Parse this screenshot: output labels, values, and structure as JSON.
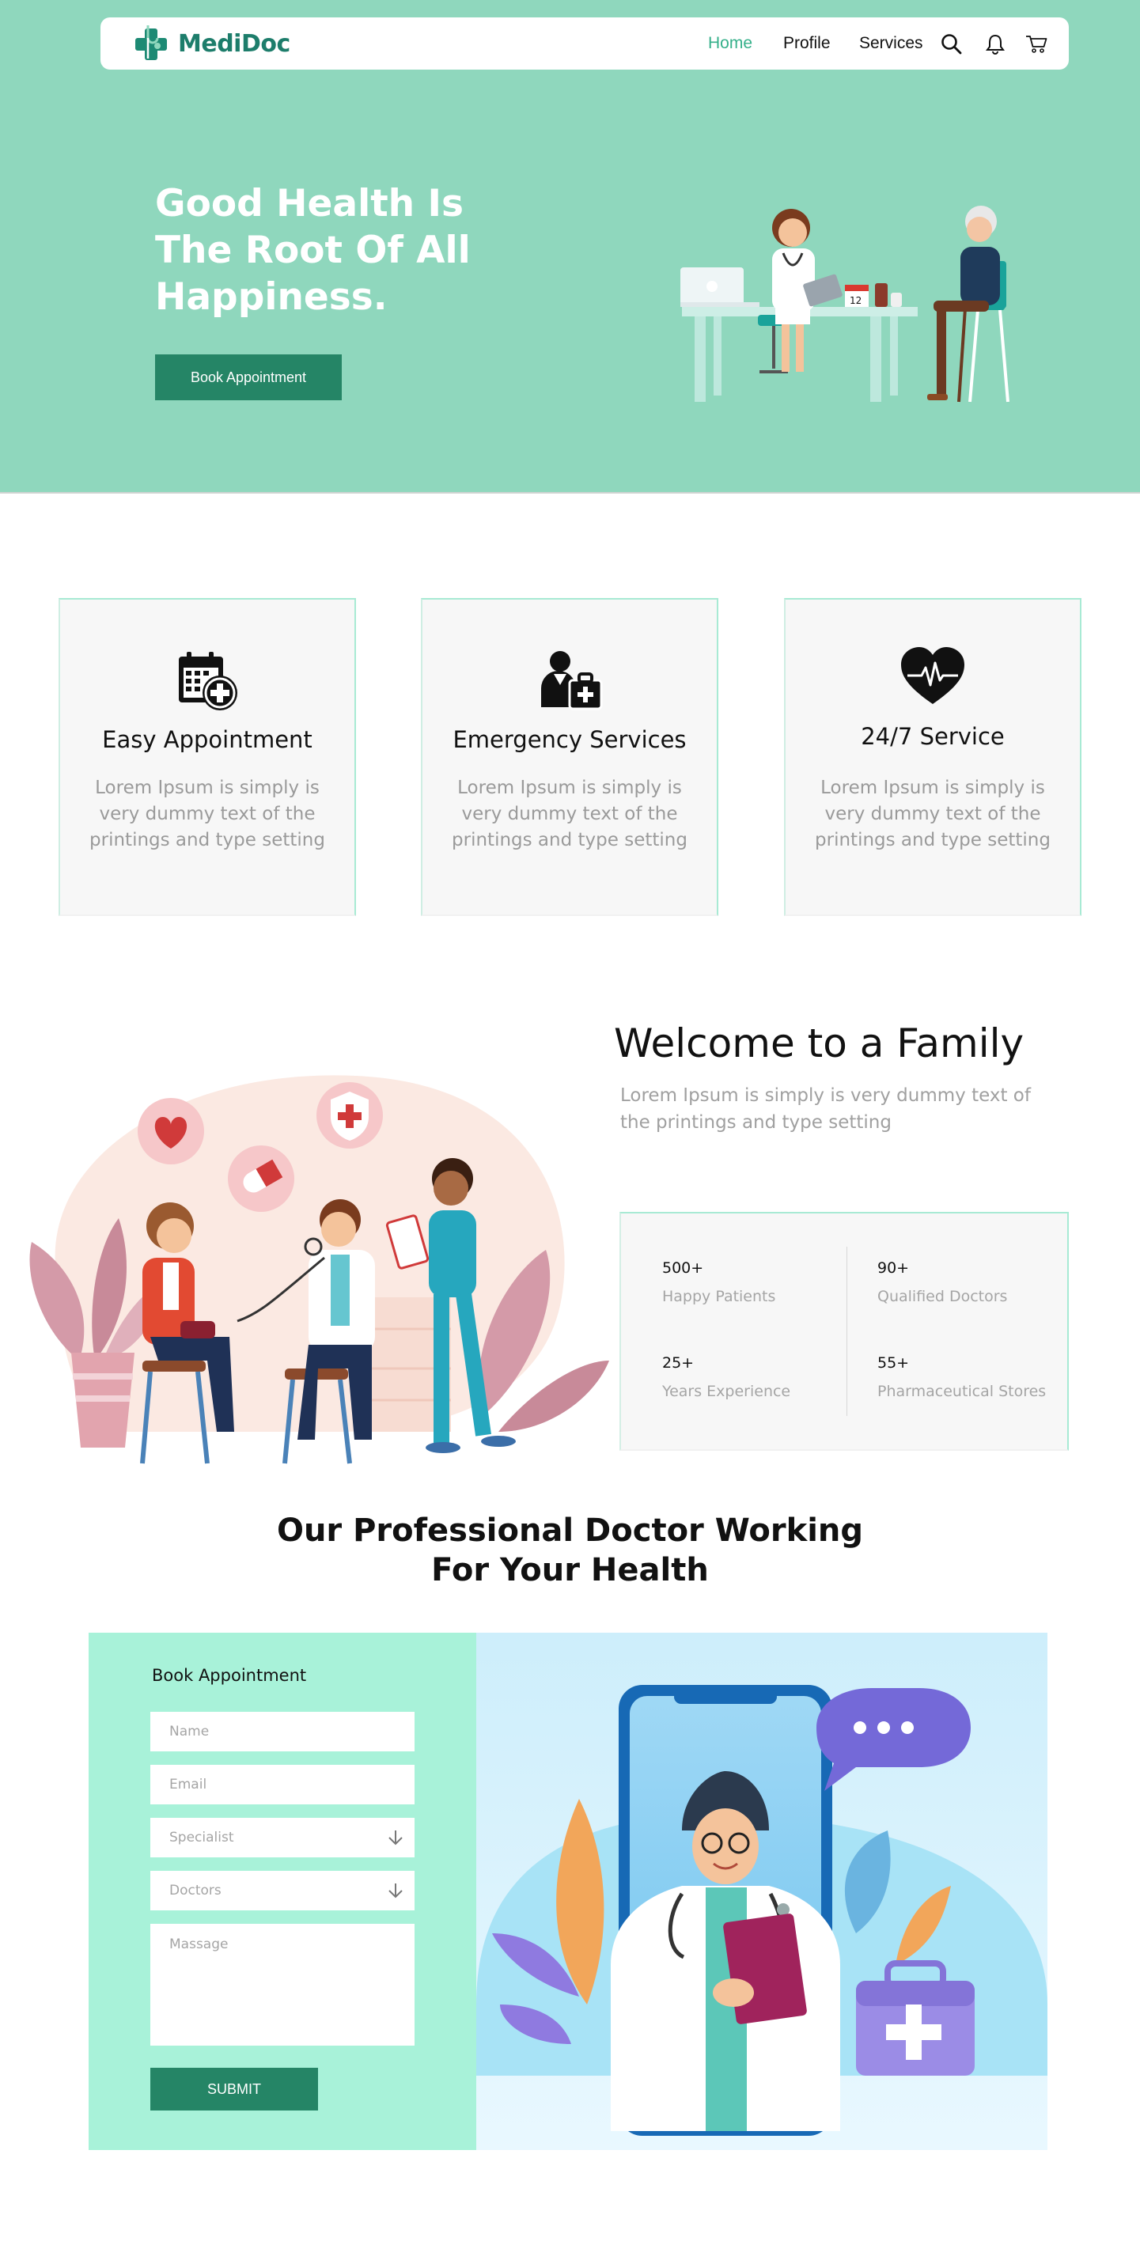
{
  "brand": {
    "name": "MediDoc",
    "accent": "#35b08a",
    "primary": "#258566",
    "hero_bg": "#8fd7bd"
  },
  "nav": {
    "links": [
      {
        "label": "Home",
        "active": true
      },
      {
        "label": "Profile",
        "active": false
      },
      {
        "label": "Services",
        "active": false
      }
    ],
    "icons": [
      "search-icon",
      "bell-icon",
      "cart-icon"
    ]
  },
  "hero": {
    "title": "Good Health Is The Root Of All Happiness.",
    "button_label": "Book Appointment"
  },
  "features": [
    {
      "icon": "calendar-plus-icon",
      "title": "Easy Appointment",
      "text": "Lorem Ipsum is simply is very dummy text of the printings and type setting"
    },
    {
      "icon": "medic-bag-icon",
      "title": "Emergency Services",
      "text": "Lorem Ipsum is simply is very dummy text of the printings and type setting"
    },
    {
      "icon": "heart-pulse-icon",
      "title": "24/7 Service",
      "text": "Lorem Ipsum is simply is very dummy text of the printings and type setting"
    }
  ],
  "welcome": {
    "title": "Welcome to a Family",
    "text": "Lorem Ipsum is simply is very dummy text of the printings and type setting",
    "stats": [
      {
        "value": "500+",
        "label": "Happy Patients"
      },
      {
        "value": "90+",
        "label": "Qualified Doctors"
      },
      {
        "value": "25+",
        "label": "Years Experience"
      },
      {
        "value": "55+",
        "label": "Pharmaceutical Stores"
      }
    ]
  },
  "doctors": {
    "title_line1": "Our Professional Doctor Working",
    "title_line2": "For Your Health"
  },
  "booking_form": {
    "title": "Book Appointment",
    "name_placeholder": "Name",
    "email_placeholder": "Email",
    "specialist_placeholder": "Specialist",
    "doctors_placeholder": "Doctors",
    "message_placeholder": "Massage",
    "submit_label": "SUBMIT"
  }
}
